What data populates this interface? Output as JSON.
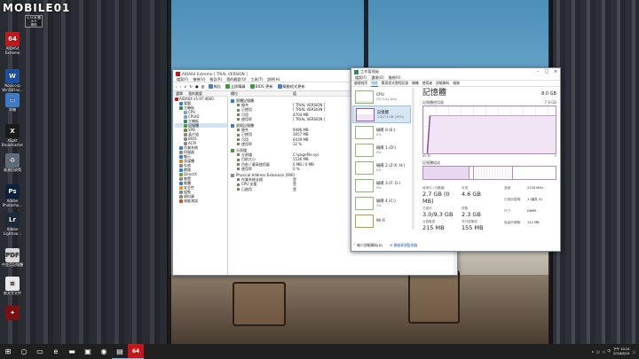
{
  "watermark": "MOBILE01",
  "desktop": {
    "top_tooltip": "1,5GB 顯示卡\n適用",
    "icons": [
      {
        "name": "aida64-icon",
        "glyph": "64",
        "color": "#c0171b",
        "label": "AIDA64\nExtreme"
      },
      {
        "name": "novicorp-icon",
        "glyph": "W",
        "color": "#1d4f9e",
        "label": "Novicorp\nWinToFlas..."
      },
      {
        "name": "thispc-icon",
        "glyph": "▭",
        "color": "#3d7bc4",
        "label": "本機"
      },
      {
        "name": "xsplit-icon",
        "glyph": "X",
        "color": "#1a1a1a",
        "label": "XSplit\nBroadcaster"
      },
      {
        "name": "recycle-bin-icon",
        "glyph": "♻",
        "color": "#5e6b78",
        "label": "資源回收筒"
      },
      {
        "name": "photoshop-icon",
        "glyph": "Ps",
        "color": "#0a2240",
        "label": "Adobe\nPhotosho..."
      },
      {
        "name": "lightroom-icon",
        "glyph": "Lr",
        "color": "#1c2b3a",
        "label": "Adobe\nLightroo..."
      },
      {
        "name": "pdf-icon",
        "glyph": "PDF",
        "color": "#d8d8d8",
        "label": "中金亞記憶體"
      },
      {
        "name": "text-file-icon",
        "glyph": "≡",
        "color": "#e8e8e8",
        "label": "新文字文件"
      },
      {
        "name": "game-icon",
        "glyph": "✦",
        "color": "#7a1010",
        "label": ""
      }
    ]
  },
  "aida": {
    "title": "AIDA64 Extreme [ TRIAL VERSION ]",
    "menu": [
      "檔案(F)",
      "檢視(V)",
      "報告(R)",
      "我的最愛(O)",
      "工具(T)",
      "說明(H)"
    ],
    "tabs": [
      "選單",
      "我的最愛"
    ],
    "toolbar": {
      "report": "報告",
      "update": "立即購買",
      "bios": "BIOS 更新",
      "driver": "驅動程式更新"
    },
    "tree": [
      {
        "label": "AIDA64 v5.97.4600",
        "indent": 0,
        "color": "#c0171b",
        "sel": false
      },
      {
        "label": "電腦",
        "indent": 1,
        "color": "#3a7bd5",
        "sel": false
      },
      {
        "label": "主機板",
        "indent": 1,
        "color": "#2e8b57",
        "sel": false
      },
      {
        "label": "CPU",
        "indent": 2,
        "color": "#7aa0c8",
        "sel": false
      },
      {
        "label": "CPUID",
        "indent": 2,
        "color": "#7aa0c8",
        "sel": false
      },
      {
        "label": "主機板",
        "indent": 2,
        "color": "#2e8b57",
        "sel": false
      },
      {
        "label": "記憶體",
        "indent": 2,
        "color": "#5c8f3a",
        "sel": true
      },
      {
        "label": "SPD",
        "indent": 2,
        "color": "#5c8f3a",
        "sel": false
      },
      {
        "label": "晶片組",
        "indent": 2,
        "color": "#888",
        "sel": false
      },
      {
        "label": "BIOS",
        "indent": 2,
        "color": "#888",
        "sel": false
      },
      {
        "label": "ACPI",
        "indent": 2,
        "color": "#888",
        "sel": false
      },
      {
        "label": "作業系統",
        "indent": 1,
        "color": "#3a7bd5",
        "sel": false
      },
      {
        "label": "伺服器",
        "indent": 1,
        "color": "#888",
        "sel": false
      },
      {
        "label": "顯示",
        "indent": 1,
        "color": "#3a7bd5",
        "sel": false
      },
      {
        "label": "多媒體",
        "indent": 1,
        "color": "#d08a1a",
        "sel": false
      },
      {
        "label": "存放",
        "indent": 1,
        "color": "#888",
        "sel": false
      },
      {
        "label": "網路",
        "indent": 1,
        "color": "#2a8ac8",
        "sel": false
      },
      {
        "label": "DirectX",
        "indent": 1,
        "color": "#6aa82a",
        "sel": false
      },
      {
        "label": "裝置",
        "indent": 1,
        "color": "#888",
        "sel": false
      },
      {
        "label": "軟體",
        "indent": 1,
        "color": "#3a7bd5",
        "sel": false
      },
      {
        "label": "安全性",
        "indent": 1,
        "color": "#d0a01a",
        "sel": false
      },
      {
        "label": "組態",
        "indent": 1,
        "color": "#888",
        "sel": false
      },
      {
        "label": "資料庫",
        "indent": 1,
        "color": "#888",
        "sel": false
      },
      {
        "label": "效能測試",
        "indent": 1,
        "color": "#c05a1a",
        "sel": false
      }
    ],
    "detail_header": {
      "field": "欄位",
      "value": "值"
    },
    "sections": [
      {
        "title": "實體記憶體",
        "rows": [
          {
            "f": "總共",
            "v": "[ TRIAL VERSION ]"
          },
          {
            "f": "已使用",
            "v": "[ TRIAL VERSION ]"
          },
          {
            "f": "可用",
            "v": "4704 MB"
          },
          {
            "f": "使用率",
            "v": "[ TRIAL VERSION ]"
          }
        ]
      },
      {
        "title": "虛擬記憶體",
        "rows": [
          {
            "f": "總共",
            "v": "9496 MB"
          },
          {
            "f": "已使用",
            "v": "3057 MB"
          },
          {
            "f": "可用",
            "v": "6439 MB"
          },
          {
            "f": "使用率",
            "v": "32 %"
          }
        ]
      },
      {
        "title": "分頁檔",
        "rows": [
          {
            "f": "分頁檔",
            "v": "C:\\pagefile.sys"
          },
          {
            "f": "目前大小",
            "v": "1536 MB"
          },
          {
            "f": "目前 / 最高使用量",
            "v": "0 MB / 0 MB"
          },
          {
            "f": "使用率",
            "v": "0 %"
          }
        ]
      },
      {
        "title": "Physical Address Extension (PAE)",
        "rows": [
          {
            "f": "作業系統支援",
            "v": "是"
          },
          {
            "f": "CPU 支援",
            "v": "是"
          },
          {
            "f": "已啟用",
            "v": "是"
          }
        ]
      }
    ]
  },
  "taskmgr": {
    "title": "工作管理員",
    "menu": [
      "檔案(F)",
      "選項(O)",
      "檢視(V)"
    ],
    "tabs": [
      "處理程序",
      "效能",
      "應用程式歷程記錄",
      "開機",
      "使用者",
      "詳細資料",
      "服務"
    ],
    "side": [
      {
        "name": "CPU",
        "sub": "2%  3.41 GHz",
        "kind": "cpu"
      },
      {
        "name": "記憶體",
        "sub": "2.8/7.9 GB (35%)",
        "kind": "mem"
      },
      {
        "name": "磁碟 0 (E:)",
        "sub": "0%",
        "kind": "disk"
      },
      {
        "name": "磁碟 1 (D:)",
        "sub": "0%",
        "kind": "disk"
      },
      {
        "name": "磁碟 2 (Z:X: H:)",
        "sub": "0%",
        "kind": "disk"
      },
      {
        "name": "磁碟 3 (F: G:)",
        "sub": "0%",
        "kind": "disk"
      },
      {
        "name": "磁碟 4 (C:)",
        "sub": "2%",
        "kind": "disk"
      },
      {
        "name": "Wi-Fi",
        "sub": "",
        "kind": "net"
      }
    ],
    "panel": {
      "title": "記憶體",
      "total": "8.0 GB",
      "usage_label": "記憶體使用量",
      "usage_max": "7.9 GB",
      "time_left": "60 秒",
      "time_right": "0",
      "composition_label": "記憶體組成",
      "stats": [
        {
          "k": "使用中 (已壓縮)",
          "v": "2.7 GB (0 MB)"
        },
        {
          "k": "可用",
          "v": "4.6 GB"
        },
        {
          "k": "已認可",
          "v": "3.0/9.3 GB"
        },
        {
          "k": "快取",
          "v": "2.3 GB"
        },
        {
          "k": "分頁集區",
          "v": "215 MB"
        },
        {
          "k": "非分頁集區",
          "v": "155 MB"
        }
      ],
      "specs": [
        {
          "k": "速度:",
          "v": "2133 MHz"
        },
        {
          "k": "已使用插槽:",
          "v": "1 (總共 4)"
        },
        {
          "k": "尺寸:",
          "v": "DIMM"
        },
        {
          "k": "保留的硬體:",
          "v": "112 MB"
        }
      ]
    },
    "footer": {
      "less": "較少詳細資料(D)",
      "monitor": "開啟資源監視器"
    }
  },
  "taskbar": {
    "icons": [
      {
        "name": "start-icon",
        "glyph": "⊞"
      },
      {
        "name": "search-icon",
        "glyph": "○"
      },
      {
        "name": "task-view-icon",
        "glyph": "▭"
      },
      {
        "name": "edge-icon",
        "glyph": "e"
      },
      {
        "name": "explorer-icon",
        "glyph": "▬"
      },
      {
        "name": "store-icon",
        "glyph": "▣"
      },
      {
        "name": "chrome-icon",
        "glyph": "◉"
      },
      {
        "name": "taskmanager-icon",
        "glyph": "▤"
      },
      {
        "name": "aida64-taskbar-icon",
        "glyph": "64"
      }
    ],
    "time": "下午 10:24",
    "date": "2018/6/19"
  }
}
